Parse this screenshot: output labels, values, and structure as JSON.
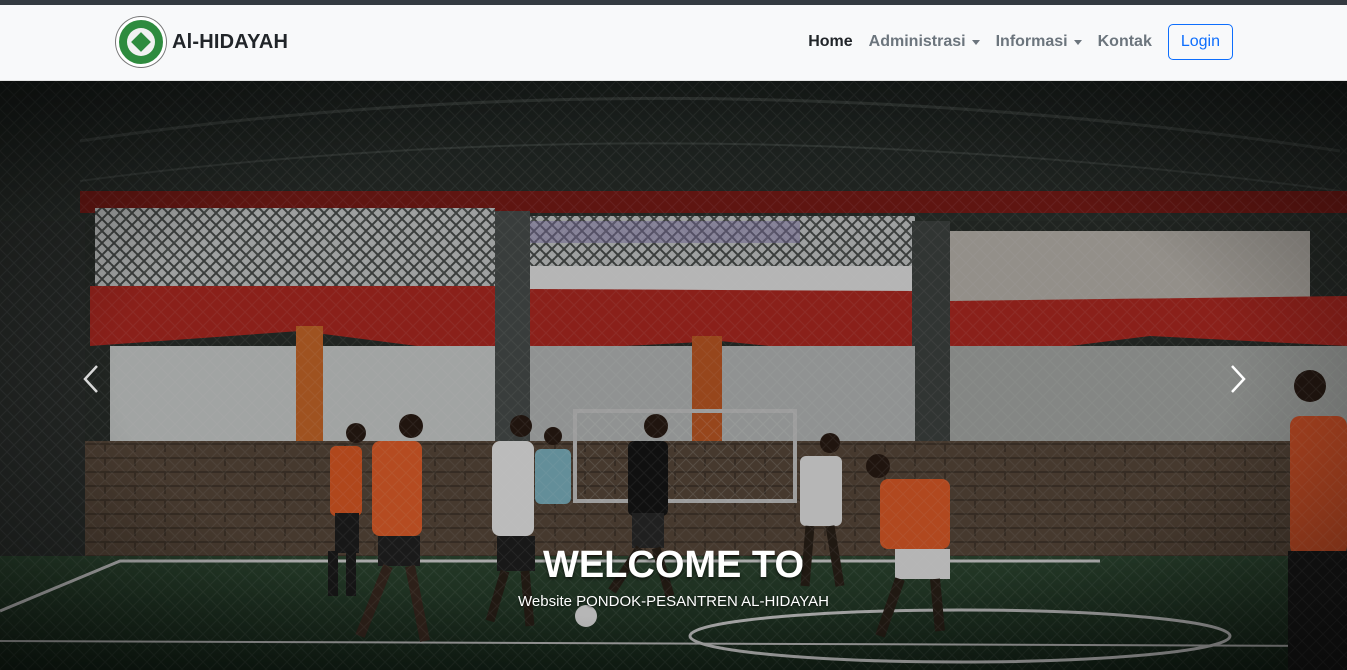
{
  "brand": {
    "name": "Al-HIDAYAH",
    "logo_icon": "school-emblem-icon"
  },
  "nav": {
    "home": "Home",
    "administrasi": "Administrasi",
    "informasi": "Informasi",
    "kontak": "Kontak",
    "login": "Login"
  },
  "hero": {
    "title": "WELCOME TO",
    "subtitle": "Website PONDOK-PESANTREN AL-HIDAYAH",
    "prev_icon": "chevron-left-icon",
    "next_icon": "chevron-right-icon"
  },
  "colors": {
    "accent": "#0d6efd",
    "navbar_bg": "#f8f9fa",
    "text_dark": "#212529",
    "text_muted": "#6c757d"
  }
}
